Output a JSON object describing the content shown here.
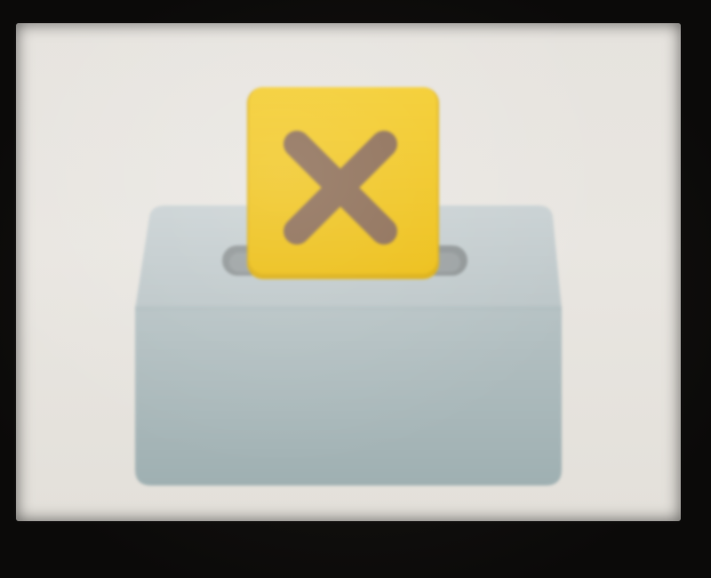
{
  "scene": {
    "emoji": "ballot-box-with-ballot",
    "ballot_mark": "x-mark",
    "colors": {
      "screen": "#e7e4df",
      "box_top": "#c4cdcf",
      "box_front": "#a9b8ba",
      "slot": "#8e9495",
      "ballot": "#f2c51a",
      "ballot_edge": "#d8a70c",
      "mark": "#8a6a52"
    }
  }
}
